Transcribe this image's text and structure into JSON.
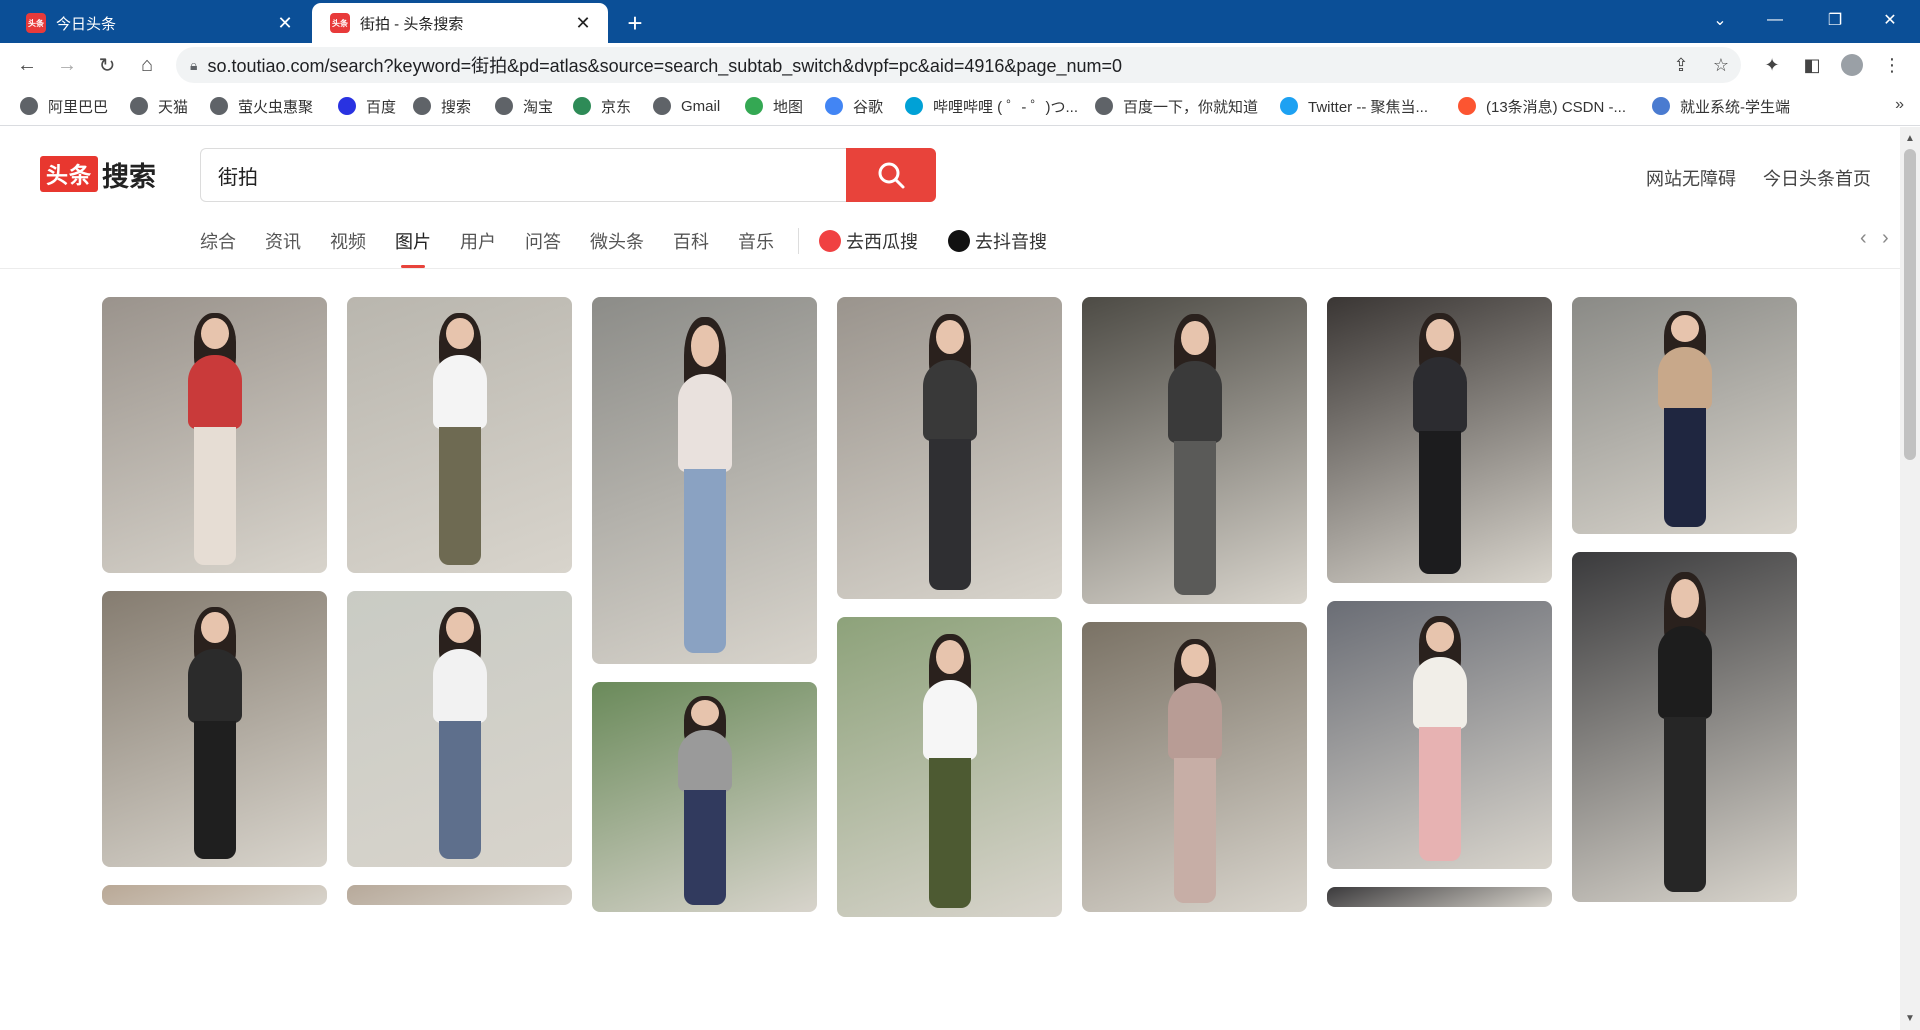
{
  "browser": {
    "tabs": [
      {
        "title": "今日头条",
        "active": false
      },
      {
        "title": "街拍 - 头条搜索",
        "active": true
      }
    ],
    "url": "so.toutiao.com/search?keyword=街拍&pd=atlas&source=search_subtab_switch&dvpf=pc&aid=4916&page_num=0",
    "bookmarks": [
      {
        "label": "阿里巴巴",
        "color": "#5f6368"
      },
      {
        "label": "天猫",
        "color": "#5f6368"
      },
      {
        "label": "萤火虫惠聚",
        "color": "#5f6368"
      },
      {
        "label": "百度",
        "color": "#2932e1"
      },
      {
        "label": "搜索",
        "color": "#5f6368"
      },
      {
        "label": "淘宝",
        "color": "#5f6368"
      },
      {
        "label": "京东",
        "color": "#2e8b57"
      },
      {
        "label": "Gmail",
        "color": "#5f6368"
      },
      {
        "label": "地图",
        "color": "#34a853"
      },
      {
        "label": "谷歌",
        "color": "#4285f4"
      },
      {
        "label": "哔哩哔哩 ( ゜- ゜)つ...",
        "color": "#00a1d6"
      },
      {
        "label": "百度一下，你就知道",
        "color": "#5f6368"
      },
      {
        "label": "Twitter -- 聚焦当...",
        "color": "#1da1f2"
      },
      {
        "label": "(13条消息) CSDN -...",
        "color": "#fc5531"
      },
      {
        "label": "就业系统-学生端",
        "color": "#4a7bd0"
      }
    ]
  },
  "site": {
    "logo_mark": "头条",
    "logo_word": "搜索",
    "search_value": "街拍",
    "top_links": [
      "网站无障碍",
      "今日头条首页"
    ],
    "subtabs": [
      "综合",
      "资讯",
      "视频",
      "图片",
      "用户",
      "问答",
      "微头条",
      "百科",
      "音乐"
    ],
    "active_subtab": "图片",
    "external_links": [
      {
        "label": "去西瓜搜",
        "color": "#f04142"
      },
      {
        "label": "去抖音搜",
        "color": "#111111"
      }
    ],
    "accent": "#e8433b"
  },
  "images": {
    "columns": [
      [
        {
          "h": 276,
          "bg": "#9a938c",
          "top": "#c93a3a",
          "bottom": "#e6ddd4"
        },
        {
          "h": 276,
          "bg": "#857c70",
          "top": "#2b2b2b",
          "bottom": "#1f1f1f"
        },
        {
          "h": 20,
          "bg": "#b9a896",
          "top": "#7a5d4b",
          "bottom": "#7a5d4b"
        }
      ],
      [
        {
          "h": 276,
          "bg": "#b9b6ae",
          "top": "#f4f4f4",
          "bottom": "#6e6a52"
        },
        {
          "h": 276,
          "bg": "#c9cbc4",
          "top": "#f2f2f2",
          "bottom": "#5e6f8c"
        },
        {
          "h": 20,
          "bg": "#b7a99a",
          "top": "#5a4638",
          "bottom": "#5a4638"
        }
      ],
      [
        {
          "h": 367,
          "bg": "#8c8c88",
          "top": "#e9e1dd",
          "bottom": "#8aa2c2"
        },
        {
          "h": 230,
          "bg": "#6a8a5a",
          "top": "#9a9a9a",
          "bottom": "#313a5e"
        }
      ],
      [
        {
          "h": 302,
          "bg": "#9a948d",
          "top": "#393939",
          "bottom": "#2f2f32"
        },
        {
          "h": 300,
          "bg": "#8da27a",
          "top": "#f6f6f6",
          "bottom": "#4d5a32"
        }
      ],
      [
        {
          "h": 307,
          "bg": "#4d4b45",
          "top": "#3a3a3a",
          "bottom": "#5a5a58"
        },
        {
          "h": 290,
          "bg": "#7a7265",
          "top": "#b89c95",
          "bottom": "#c7aea6"
        }
      ],
      [
        {
          "h": 286,
          "bg": "#3a3634",
          "top": "#2c2c30",
          "bottom": "#1c1c1e"
        },
        {
          "h": 268,
          "bg": "#6a6d75",
          "top": "#f1eee8",
          "bottom": "#e7b2b2"
        },
        {
          "h": 20,
          "bg": "#3b3a3c",
          "top": "#3b3a3c",
          "bottom": "#3b3a3c"
        }
      ],
      [
        {
          "h": 237,
          "bg": "#8a8a86",
          "top": "#c8a88a",
          "bottom": "#1f2640"
        },
        {
          "h": 350,
          "bg": "#3a3a3c",
          "top": "#1d1d1d",
          "bottom": "#262626"
        }
      ]
    ]
  }
}
